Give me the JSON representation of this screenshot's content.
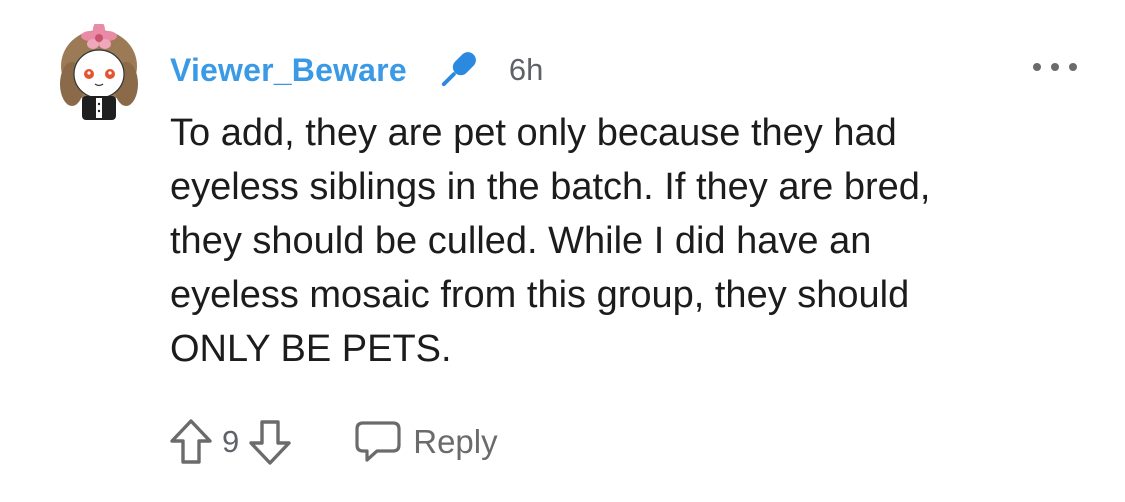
{
  "comment": {
    "author": "Viewer_Beware",
    "author_badge_icon": "microphone-icon",
    "timestamp": "6h",
    "body_lines": [
      "To add, they are pet only because they had",
      "eyeless siblings in the batch. If they are bred,",
      "they should be culled. While I did have an",
      "eyeless mosaic from this group, they should",
      "ONLY BE PETS."
    ],
    "score": "9",
    "reply_label": "Reply",
    "more_icon": "more-dots-icon",
    "upvote_icon": "upvote-arrow-icon",
    "downvote_icon": "downvote-arrow-icon",
    "reply_icon": "speech-bubble-icon"
  },
  "colors": {
    "username": "#3b9ae6",
    "meta": "#5f6368",
    "body": "#1c1c1c",
    "accent_flower": "#e98aa6"
  }
}
